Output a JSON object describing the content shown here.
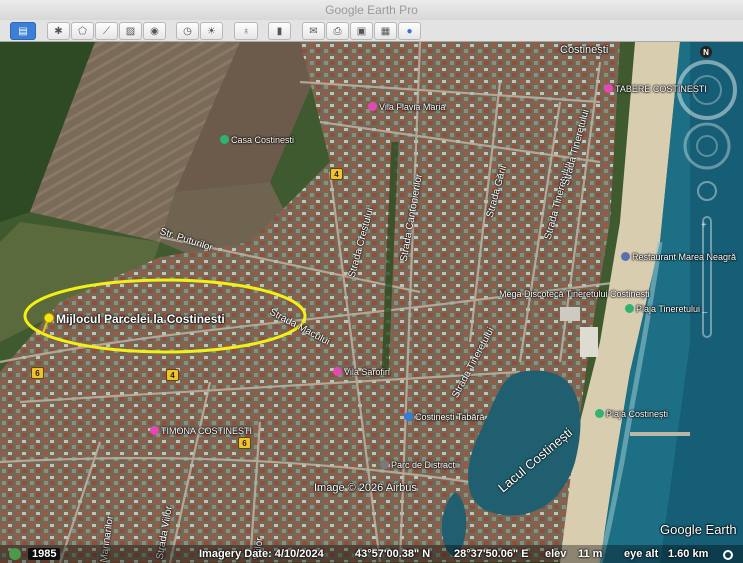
{
  "window": {
    "title": "Google Earth Pro"
  },
  "toolbar": {
    "buttons": [
      {
        "name": "sidebar-toggle-button",
        "icon": "sidebar-icon",
        "glyph": "▤",
        "active": true
      },
      {
        "name": "add-placemark-button",
        "icon": "placemark-star-icon",
        "glyph": "✱"
      },
      {
        "name": "add-polygon-button",
        "icon": "polygon-icon",
        "glyph": "⬠"
      },
      {
        "name": "add-path-button",
        "icon": "path-icon",
        "glyph": "⟋"
      },
      {
        "name": "add-overlay-button",
        "icon": "image-overlay-icon",
        "glyph": "▨"
      },
      {
        "name": "record-tour-button",
        "icon": "record-tour-icon",
        "glyph": "◉"
      },
      {
        "name": "historical-imagery-button",
        "icon": "history-clock-icon",
        "glyph": "◷"
      },
      {
        "name": "sunlight-button",
        "icon": "sun-icon",
        "glyph": "☀"
      },
      {
        "name": "switch-planet-button",
        "icon": "planet-icon",
        "glyph": "♁"
      },
      {
        "name": "ruler-button",
        "icon": "ruler-icon",
        "glyph": "▮"
      },
      {
        "name": "email-button",
        "icon": "envelope-icon",
        "glyph": "✉"
      },
      {
        "name": "print-button",
        "icon": "printer-icon",
        "glyph": "⎙"
      },
      {
        "name": "save-image-button",
        "icon": "save-image-icon",
        "glyph": "▣"
      },
      {
        "name": "view-in-maps-button",
        "icon": "map-view-icon",
        "glyph": "▦"
      },
      {
        "name": "earth-gallery-button",
        "icon": "globe-icon",
        "glyph": "●"
      }
    ]
  },
  "map": {
    "placemark": {
      "label": "Mijlocul Parcelei la Costinesti",
      "icon": "pushpin-icon"
    },
    "pois": [
      {
        "name": "poi-vila-flavia-maria",
        "label": "Vila Flavia Maria",
        "color": "#e04bb3"
      },
      {
        "name": "poi-casa-costinesti",
        "label": "Casa Costinesti",
        "color": "#2fb36f"
      },
      {
        "name": "poi-tabere-costinesti",
        "label": "TABERE COSTINEȘTI",
        "color": "#e04bb3"
      },
      {
        "name": "poi-restaurant-marea-neagra",
        "label": "Restaurant Marea Neagră",
        "color": "#5a6fb0"
      },
      {
        "name": "poi-mega-discoteca",
        "label": "Mega Discotecă Tineretului Costinești",
        "color": "#6a6a6a"
      },
      {
        "name": "poi-plaja-tineretului",
        "label": "Plaja Tineretului",
        "color": "#2fb36f"
      },
      {
        "name": "poi-vila-sarofin",
        "label": "Vila Sarofin",
        "color": "#e04bb3"
      },
      {
        "name": "poi-costinesti-tabara",
        "label": "Costinești Tabără",
        "color": "#3a7bd5"
      },
      {
        "name": "poi-plaja-costinesti",
        "label": "Plaja Costinești",
        "color": "#2fb36f"
      },
      {
        "name": "poi-timona-costinesti",
        "label": "TIMONA COSTINEȘTI",
        "color": "#e04bb3"
      },
      {
        "name": "poi-parc-de-distractii",
        "label": "Parc de Distracții",
        "color": "#7a7a7a"
      }
    ],
    "town_label": "Costinești",
    "lake_label": "Lacul Costinești",
    "streets": [
      {
        "name": "street-puturilor",
        "label": "Str. Puturilor"
      },
      {
        "name": "street-macului",
        "label": "Strada Macului"
      },
      {
        "name": "street-crestului",
        "label": "Strada Crestului"
      },
      {
        "name": "street-cantonierilor",
        "label": "Strada Cantonierilor"
      },
      {
        "name": "street-garii",
        "label": "Strada Gării"
      },
      {
        "name": "street-tineretului-1",
        "label": "Strada Tineretului"
      },
      {
        "name": "street-tineretului-2",
        "label": "Strada Tineretului"
      },
      {
        "name": "street-tineretului-3",
        "label": "Strada Tineretului"
      },
      {
        "name": "street-marinarilor",
        "label": "Marinarilor"
      },
      {
        "name": "street-viilor",
        "label": "Strada Viilor"
      },
      {
        "name": "street-viilor-short",
        "label": "Viilor"
      }
    ],
    "road_signs": [
      "4",
      "6",
      "4",
      "6"
    ],
    "attribution": "Image © 2026 Airbus",
    "watermark": "Google Earth",
    "compass_n": "N"
  },
  "status": {
    "year": "1985",
    "imagery_date": "Imagery Date: 4/10/2024",
    "lat": "43°57'00.38\" N",
    "lon": "28°37'50.06\" E",
    "elev": "elev",
    "elev_value": "11 m",
    "eye_alt": "eye alt",
    "eye_alt_value": "1.60 km"
  },
  "colors": {
    "accent": "#3b7fd6",
    "highlight_ellipse": "#f3f014",
    "sea": "#1d6f86"
  }
}
